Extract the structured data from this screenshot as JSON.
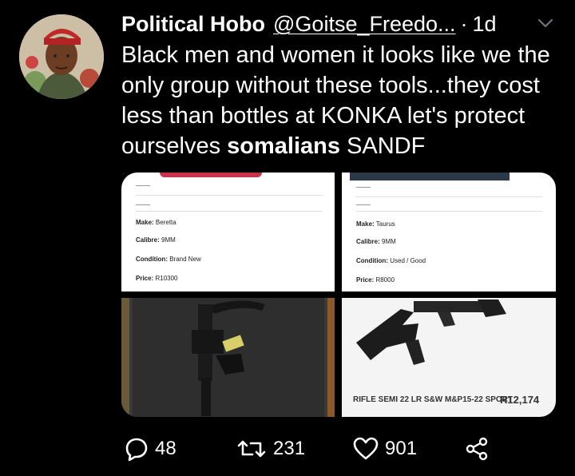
{
  "tweet": {
    "author_name": "Political Hobo",
    "handle": "@Goitse_Freedo...",
    "separator": "·",
    "time": "1d",
    "text_before": "Black men and women it looks like we the only group without these tools...they cost less than bottles at KONKA let's protect ourselves ",
    "text_bold": "somalians",
    "text_after": " SANDF"
  },
  "media": {
    "listing1": {
      "make_label": "Make:",
      "make_value": "Beretta",
      "calibre_label": "Calibre:",
      "calibre_value": "9MM",
      "condition_label": "Condition:",
      "condition_value": "Brand New",
      "price_label": "Price:",
      "price_value": "R10300"
    },
    "listing2": {
      "make_label": "Make:",
      "make_value": "Taurus",
      "calibre_label": "Calibre:",
      "calibre_value": "9MM",
      "condition_label": "Condition:",
      "condition_value": "Used / Good",
      "price_label": "Price:",
      "price_value": "R8000"
    },
    "listing4": {
      "product_title": "RIFLE SEMI 22 LR S&W M&P15-22 SPORT",
      "price": "R12,174"
    }
  },
  "actions": {
    "replies": "48",
    "retweets": "231",
    "likes": "901"
  },
  "icons": [
    "reply-icon",
    "retweet-icon",
    "like-icon",
    "share-icon",
    "chevron-down-icon"
  ]
}
